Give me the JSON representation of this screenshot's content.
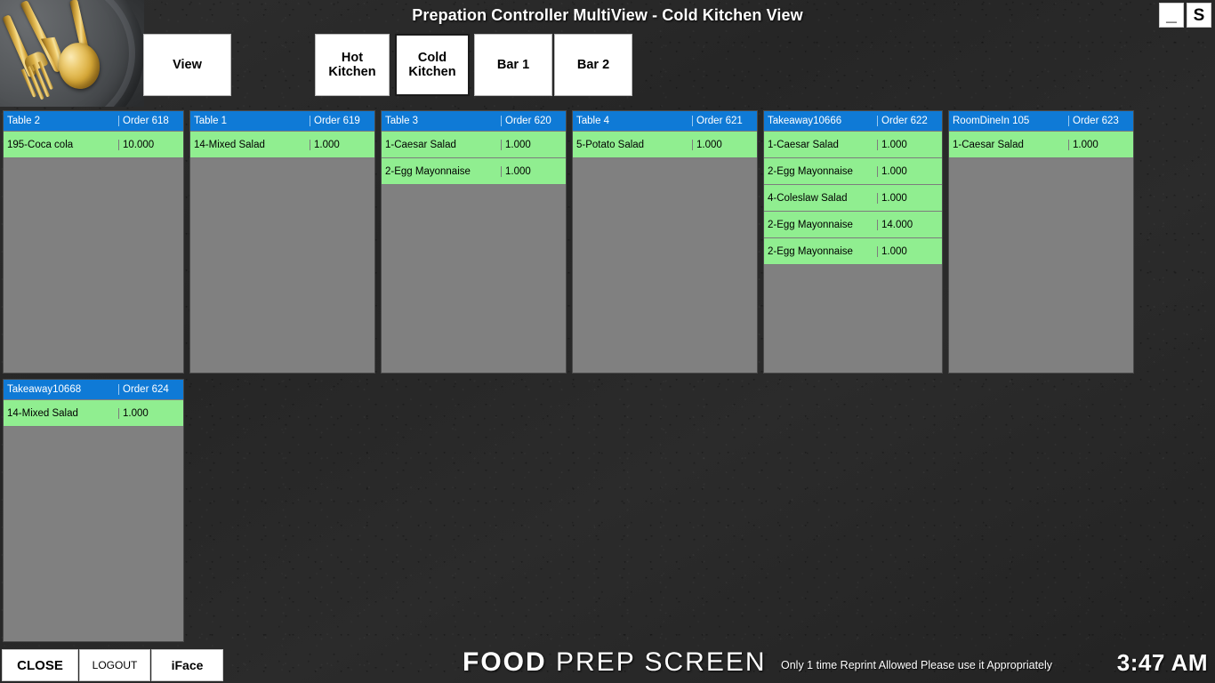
{
  "window": {
    "title": "Prepation Controller MultiView - Cold Kitchen View",
    "minimize_label": "_",
    "s_label": "S"
  },
  "decor": {
    "plate_photo_alt": "gold cutlery on dark plate"
  },
  "toolbar": {
    "view_label": "View",
    "tabs": [
      {
        "label": "Hot\nKitchen",
        "name": "hot-kitchen",
        "active": false
      },
      {
        "label": "Cold\nKitchen",
        "name": "cold-kitchen",
        "active": true
      },
      {
        "label": "Bar 1",
        "name": "bar-1",
        "active": false
      },
      {
        "label": "Bar 2",
        "name": "bar-2",
        "active": false
      }
    ]
  },
  "colors": {
    "header_blue": "#0f7ad6",
    "item_green": "#90ee90",
    "card_gray": "#808080",
    "background": "#282828"
  },
  "orders": [
    {
      "table": "Table 2",
      "order": "Order 618",
      "items": [
        {
          "name": "195-Coca cola",
          "qty": "10.000"
        }
      ]
    },
    {
      "table": "Table 1",
      "order": "Order 619",
      "items": [
        {
          "name": "14-Mixed Salad",
          "qty": "1.000"
        }
      ]
    },
    {
      "table": "Table 3",
      "order": "Order 620",
      "items": [
        {
          "name": "1-Caesar Salad",
          "qty": "1.000"
        },
        {
          "name": "2-Egg Mayonnaise",
          "qty": "1.000"
        }
      ]
    },
    {
      "table": "Table 4",
      "order": "Order 621",
      "items": [
        {
          "name": "5-Potato Salad",
          "qty": "1.000"
        }
      ]
    },
    {
      "table": "Takeaway10666",
      "order": "Order 622",
      "items": [
        {
          "name": "1-Caesar Salad",
          "qty": "1.000"
        },
        {
          "name": "2-Egg Mayonnaise",
          "qty": "1.000"
        },
        {
          "name": "4-Coleslaw Salad",
          "qty": "1.000"
        },
        {
          "name": "2-Egg Mayonnaise",
          "qty": "14.000"
        },
        {
          "name": "2-Egg Mayonnaise",
          "qty": "1.000"
        }
      ]
    },
    {
      "table": "RoomDineIn 105",
      "order": "Order 623",
      "items": [
        {
          "name": "1-Caesar Salad",
          "qty": "1.000"
        }
      ]
    },
    {
      "table": "Takeaway10668",
      "order": "Order 624",
      "items": [
        {
          "name": "14-Mixed Salad",
          "qty": "1.000"
        }
      ]
    }
  ],
  "footer": {
    "close_label": "CLOSE",
    "logout_label": "LOGOUT",
    "iface_label": "iFace",
    "brand_strong": "FOOD",
    "brand_light": " PREP SCREEN",
    "reprint_notice": "Only 1 time Reprint Allowed  Please use it Appropriately",
    "clock": "3:47 AM"
  }
}
